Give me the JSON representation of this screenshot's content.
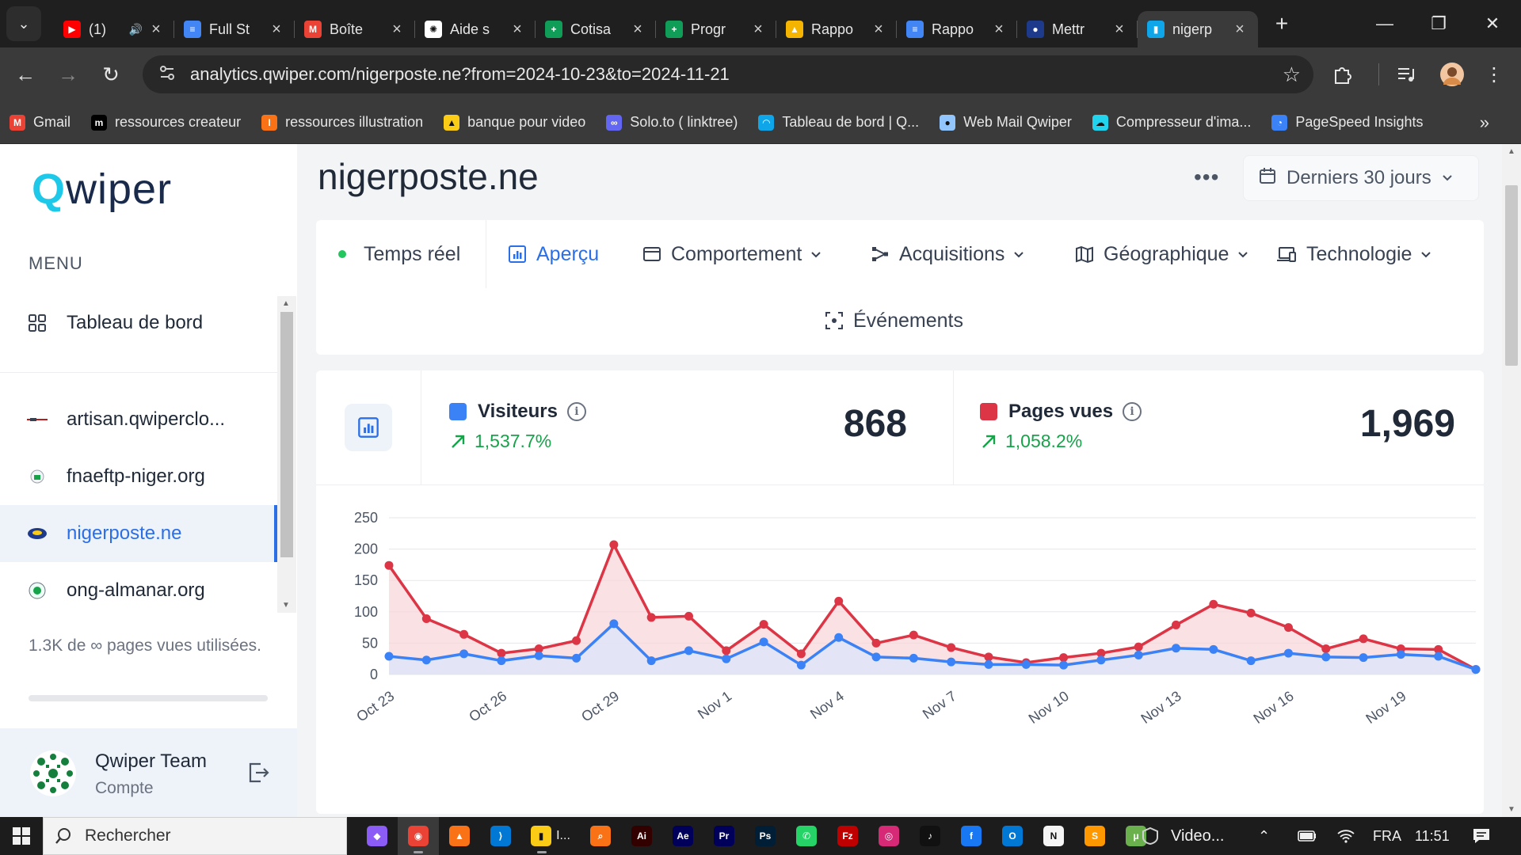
{
  "browser": {
    "tabs": [
      {
        "title": "(1)",
        "icon": "youtube-icon",
        "color": "#ff0000",
        "glyph": "▶",
        "audio": true
      },
      {
        "title": "Full St",
        "icon": "docs-icon",
        "color": "#4285f4",
        "glyph": "≡"
      },
      {
        "title": "Boîte",
        "icon": "gmail-icon",
        "color": "#ea4335",
        "glyph": "M"
      },
      {
        "title": "Aide s",
        "icon": "chatgpt-icon",
        "color": "#ffffff",
        "glyph": "✺"
      },
      {
        "title": "Cotisa",
        "icon": "sheets-icon",
        "color": "#0f9d58",
        "glyph": "+"
      },
      {
        "title": "Progr",
        "icon": "sheets-icon",
        "color": "#0f9d58",
        "glyph": "+"
      },
      {
        "title": "Rappo",
        "icon": "drive-icon",
        "color": "#f4b400",
        "glyph": "▲"
      },
      {
        "title": "Rappo",
        "icon": "docs-icon",
        "color": "#4285f4",
        "glyph": "≡"
      },
      {
        "title": "Mettr",
        "icon": "site-icon",
        "color": "#1e3a8a",
        "glyph": "●"
      },
      {
        "title": "nigerp",
        "icon": "qwiper-icon",
        "color": "#0ea5e9",
        "glyph": "▮",
        "active": true
      }
    ],
    "url": "analytics.qwiper.com/nigerposte.ne?from=2024-10-23&to=2024-11-21",
    "bookmarks": [
      {
        "label": "Gmail",
        "icon": "gmail-icon",
        "color": "#ea4335",
        "glyph": "M"
      },
      {
        "label": "ressources createur",
        "icon": "medium-icon",
        "color": "#000000",
        "glyph": "m"
      },
      {
        "label": "ressources illustration",
        "icon": "illustration-icon",
        "color": "#f97316",
        "glyph": "I"
      },
      {
        "label": "banque pour video",
        "icon": "warning-triangle-icon",
        "color": "#facc15",
        "glyph": "▲"
      },
      {
        "label": "Solo.to ( linktree)",
        "icon": "link-icon",
        "color": "#6366f1",
        "glyph": "∞"
      },
      {
        "label": "Tableau de bord | Q...",
        "icon": "qwiper-icon",
        "color": "#0ea5e9",
        "glyph": "◠"
      },
      {
        "label": "Web Mail Qwiper",
        "icon": "webmail-icon",
        "color": "#93c5fd",
        "glyph": "●"
      },
      {
        "label": "Compresseur d'ima...",
        "icon": "compress-icon",
        "color": "#22d3ee",
        "glyph": "☁"
      },
      {
        "label": "PageSpeed Insights",
        "icon": "pagespeed-icon",
        "color": "#3b82f6",
        "glyph": "◔"
      }
    ]
  },
  "sidebar": {
    "logo": {
      "q": "Q",
      "rest": "wiper"
    },
    "menu_label": "MENU",
    "dashboard": "Tableau de bord",
    "sites": [
      {
        "label": "artisan.qwiperclo...",
        "icon": "artisan-favicon"
      },
      {
        "label": "fnaeftp-niger.org",
        "icon": "fnaeftp-favicon"
      },
      {
        "label": "nigerposte.ne",
        "icon": "nigerposte-favicon",
        "active": true
      },
      {
        "label": "ong-almanar.org",
        "icon": "almanar-favicon"
      }
    ],
    "usage": "1.3K de ∞ pages vues utilisées.",
    "account": {
      "name": "Qwiper Team",
      "role": "Compte"
    }
  },
  "header": {
    "title": "nigerposte.ne",
    "more": "•••",
    "date_range": "Derniers 30 jours"
  },
  "nav": {
    "realtime": "Temps réel",
    "overview": "Aperçu",
    "behavior": "Comportement",
    "acquisitions": "Acquisitions",
    "geographic": "Géographique",
    "technology": "Technologie",
    "events": "Événements"
  },
  "stats": {
    "visitors": {
      "label": "Visiteurs",
      "change": "1,537.7%",
      "value": "868",
      "color": "#3b82f6"
    },
    "pageviews": {
      "label": "Pages vues",
      "change": "1,058.2%",
      "value": "1,969",
      "color": "#dc3545"
    }
  },
  "chart_data": {
    "type": "area",
    "x": [
      "Oct 23",
      "Oct 24",
      "Oct 25",
      "Oct 26",
      "Oct 27",
      "Oct 28",
      "Oct 29",
      "Oct 30",
      "Oct 31",
      "Nov 1",
      "Nov 2",
      "Nov 3",
      "Nov 4",
      "Nov 5",
      "Nov 6",
      "Nov 7",
      "Nov 8",
      "Nov 9",
      "Nov 10",
      "Nov 11",
      "Nov 12",
      "Nov 13",
      "Nov 14",
      "Nov 15",
      "Nov 16",
      "Nov 17",
      "Nov 18",
      "Nov 19",
      "Nov 20",
      "Nov 21"
    ],
    "tick_labels": [
      "Oct 23",
      "Oct 26",
      "Oct 29",
      "Nov 1",
      "Nov 4",
      "Nov 7",
      "Nov 10",
      "Nov 13",
      "Nov 16",
      "Nov 19"
    ],
    "series": [
      {
        "name": "Pages vues",
        "color": "#dc3545",
        "fill": "#f8d7da",
        "values": [
          174,
          89,
          64,
          34,
          41,
          54,
          207,
          91,
          93,
          38,
          80,
          33,
          117,
          50,
          63,
          43,
          28,
          19,
          27,
          34,
          44,
          79,
          112,
          98,
          75,
          41,
          57,
          41,
          40,
          8
        ]
      },
      {
        "name": "Visiteurs",
        "color": "#3b82f6",
        "fill": "#dbe4fb",
        "values": [
          29,
          23,
          33,
          22,
          30,
          26,
          81,
          22,
          38,
          25,
          52,
          15,
          59,
          28,
          26,
          20,
          16,
          16,
          15,
          23,
          31,
          42,
          40,
          22,
          34,
          28,
          27,
          32,
          29,
          8
        ]
      }
    ],
    "ylim": [
      0,
      250
    ],
    "yticks": [
      0,
      50,
      100,
      150,
      200,
      250
    ],
    "grid": true
  },
  "taskbar": {
    "search_placeholder": "Rechercher",
    "apps": [
      {
        "icon": "copilot-icon",
        "color": "#8b5cf6",
        "glyph": "◆"
      },
      {
        "icon": "chrome-icon",
        "color": "#ea4335",
        "glyph": "◉",
        "active": true
      },
      {
        "icon": "vlc-icon",
        "color": "#f97316",
        "glyph": "▲"
      },
      {
        "icon": "vscode-icon",
        "color": "#0078d4",
        "glyph": "⟩"
      },
      {
        "icon": "file-explorer-icon",
        "color": "#facc15",
        "glyph": "▮",
        "label": "I..."
      },
      {
        "icon": "search-everything-icon",
        "color": "#f97316",
        "glyph": "⌕"
      },
      {
        "icon": "illustrator-icon",
        "color": "#330000",
        "glyph": "Ai"
      },
      {
        "icon": "after-effects-icon",
        "color": "#00005b",
        "glyph": "Ae"
      },
      {
        "icon": "premiere-icon",
        "color": "#00005b",
        "glyph": "Pr"
      },
      {
        "icon": "photoshop-icon",
        "color": "#001e36",
        "glyph": "Ps"
      },
      {
        "icon": "whatsapp-icon",
        "color": "#25d366",
        "glyph": "✆"
      },
      {
        "icon": "filezilla-icon",
        "color": "#bf0000",
        "glyph": "Fz"
      },
      {
        "icon": "instagram-icon",
        "color": "#d62976",
        "glyph": "◎"
      },
      {
        "icon": "tiktok-icon",
        "color": "#111111",
        "glyph": "♪"
      },
      {
        "icon": "facebook-icon",
        "color": "#1877f2",
        "glyph": "f"
      },
      {
        "icon": "outlook-icon",
        "color": "#0078d4",
        "glyph": "O"
      },
      {
        "icon": "notion-icon",
        "color": "#f5f5f5",
        "glyph": "N"
      },
      {
        "icon": "sublime-icon",
        "color": "#ff9800",
        "glyph": "S"
      },
      {
        "icon": "utorrent-icon",
        "color": "#6ab04c",
        "glyph": "μ"
      }
    ],
    "running_label": "Video...",
    "lang": "FRA",
    "time": "11:51"
  }
}
